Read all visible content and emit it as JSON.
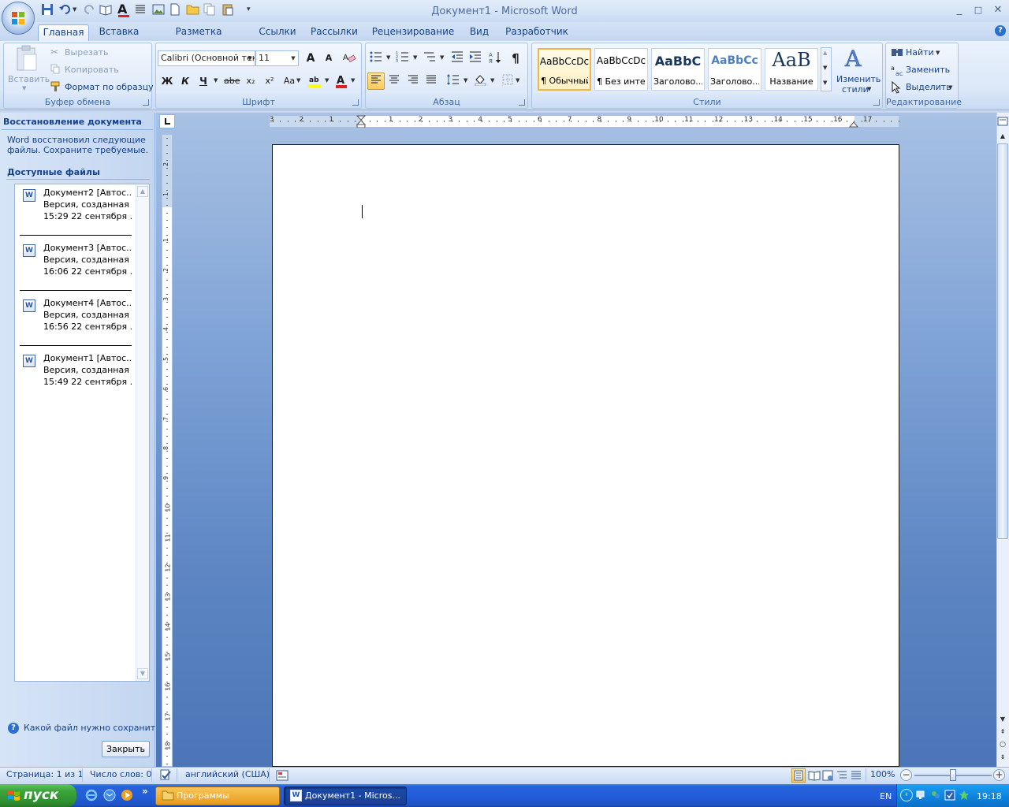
{
  "window": {
    "title": "Документ1 - Microsoft Word",
    "min": "_",
    "max": "□",
    "close": "✕"
  },
  "tabs": [
    "Главная",
    "Вставка",
    "Разметка страницы",
    "Ссылки",
    "Рассылки",
    "Рецензирование",
    "Вид",
    "Разработчик"
  ],
  "clipboard": {
    "paste": "Вставить",
    "cut": "Вырезать",
    "copy": "Копировать",
    "format_painter": "Формат по образцу",
    "label": "Буфер обмена"
  },
  "font": {
    "name": "Calibri (Основной текст)",
    "size": "11",
    "bold": "Ж",
    "italic": "К",
    "underline": "Ч",
    "strike": "abe",
    "sub": "x₂",
    "sup": "x²",
    "case": "Aa",
    "grow": "A",
    "shrink": "A",
    "label": "Шрифт"
  },
  "paragraph": {
    "label": "Абзац",
    "pilcrow": "¶"
  },
  "styles": {
    "label": "Стили",
    "items": [
      {
        "sample": "AaBbCcDc",
        "name": "¶ Обычный"
      },
      {
        "sample": "AaBbCcDc",
        "name": "¶ Без инте..."
      },
      {
        "sample": "AaBbC",
        "name": "Заголово..."
      },
      {
        "sample": "AaBbCc",
        "name": "Заголово..."
      },
      {
        "sample": "AaB",
        "name": "Название"
      }
    ],
    "change_styles_line1": "Изменить",
    "change_styles_line2": "стили"
  },
  "editing": {
    "label": "Редактирование",
    "find": "Найти",
    "replace": "Заменить",
    "select": "Выделить"
  },
  "recovery": {
    "title": "Восстановление документа",
    "description": "Word восстановил следующие файлы.  Сохраните требуемые.",
    "available": "Доступные файлы",
    "files": [
      {
        "name": "Документ2  [Автос...",
        "version": "Версия, созданная ...",
        "time": "15:29 22 сентября ..."
      },
      {
        "name": "Документ3  [Автос...",
        "version": "Версия, созданная ...",
        "time": "16:06 22 сентября ..."
      },
      {
        "name": "Документ4  [Автос...",
        "version": "Версия, созданная ...",
        "time": "16:56 22 сентября ..."
      },
      {
        "name": "Документ1  [Автос...",
        "version": "Версия, созданная ...",
        "time": "15:49 22 сентября ..."
      }
    ],
    "help": "Какой файл нужно сохранить?",
    "close": "Закрыть"
  },
  "ruler": {
    "h_ticks": [
      "3",
      "2",
      "1",
      "1",
      "2",
      "3",
      "4",
      "5",
      "6",
      "7",
      "8",
      "9",
      "10",
      "11",
      "12",
      "13",
      "14",
      "15",
      "16",
      "17"
    ],
    "v_ticks": [
      "2",
      "1",
      "1",
      "2",
      "3",
      "4",
      "5",
      "6",
      "7",
      "8",
      "9",
      "10",
      "11",
      "12",
      "13",
      "14",
      "15",
      "16",
      "17",
      "18"
    ]
  },
  "status": {
    "page": "Страница: 1 из 1",
    "words": "Число слов: 0",
    "language": "английский (США)",
    "zoom": "100%"
  },
  "taskbar": {
    "start": "пуск",
    "programs": "Программы",
    "word": "Документ1 - Micros...",
    "lang": "EN",
    "clock": "19:18"
  },
  "colors": {
    "ribbon_bg": "#dbe8f8",
    "accent_text": "#15428b",
    "doc_bg": "#6f95cd",
    "taskbar": "#245edb",
    "start_green": "#3aa53a"
  }
}
